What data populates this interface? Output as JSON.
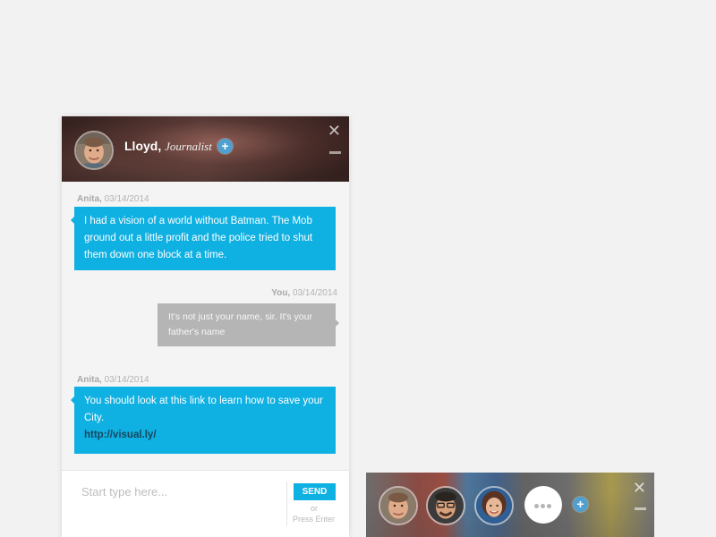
{
  "chat": {
    "contact_name": "Lloyd,",
    "contact_role": "Journalist",
    "add_icon": "plus-icon",
    "close_icon": "close-icon",
    "minimize_icon": "minimize-icon",
    "messages": [
      {
        "sender": "Anita,",
        "date": "03/14/2014",
        "direction": "incoming",
        "text": "I had a vision of a world without Batman. The Mob ground out a little profit and the police tried to shut them down one block at a time."
      },
      {
        "sender": "You,",
        "date": "03/14/2014",
        "direction": "outgoing",
        "text": "It's not just your name, sir. It's your father's name"
      },
      {
        "sender": "Anita,",
        "date": "03/14/2014",
        "direction": "incoming",
        "text": "You should look at this link to learn how to save your City.",
        "link": "http://visual.ly/"
      }
    ],
    "composer": {
      "placeholder": "Start type here...",
      "send_label": "SEND",
      "or_label": "or",
      "hint": "Press Enter"
    }
  },
  "group_bar": {
    "more_icon": "more-dots-icon",
    "add_icon": "plus-icon",
    "close_icon": "close-icon",
    "minimize_icon": "minimize-icon"
  },
  "colors": {
    "incoming_bubble": "#0fb0e2",
    "outgoing_bubble": "#b5b5b5",
    "accent_button": "#0fb0e2",
    "add_button": "#4f9fd0"
  }
}
